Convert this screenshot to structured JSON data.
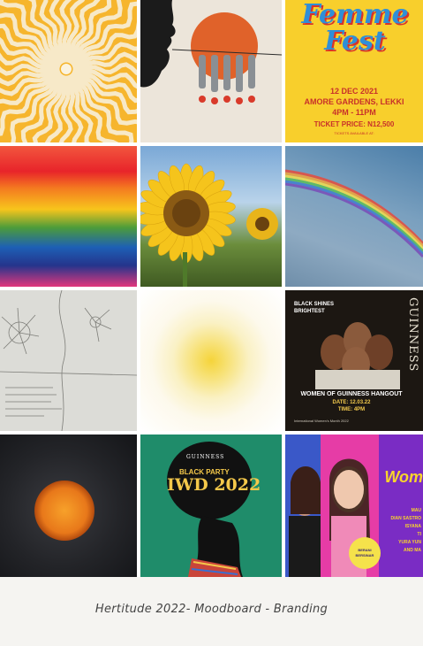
{
  "gallery": {
    "tiles": [
      {
        "name": "sun-rays-artwork"
      },
      {
        "name": "silhouette-bottles-artwork"
      },
      {
        "name": "femme-fest-poster",
        "title": "Femme Fest",
        "date": "12 DEC 2021",
        "venue": "AMORE GARDENS, LEKKI",
        "time": "4PM - 11PM",
        "price": "TICKET PRICE: N12,500",
        "tickets": "TICKETS AVAILABLE AT:"
      },
      {
        "name": "rainbow-paint-texture"
      },
      {
        "name": "sunflower-photo"
      },
      {
        "name": "rainbow-sky-photo"
      },
      {
        "name": "pencil-sketch"
      },
      {
        "name": "glowing-sun-illustration"
      },
      {
        "name": "guinness-hangout-poster",
        "brand": "GUINNESS",
        "tagline": "BLACK SHINES BRIGHTEST",
        "headline": "WOMEN OF GUINNESS HANGOUT",
        "date": "DATE: 12.03.22",
        "time": "TIME: 4PM",
        "footer": "International Women's Month 2022"
      },
      {
        "name": "orange-sun-photo"
      },
      {
        "name": "iwd-2022-poster",
        "brand": "GUINNESS",
        "party": "BLACK PARTY",
        "title": "IWD 2022"
      },
      {
        "name": "women-event-poster",
        "title": "Wom",
        "names": "MAU\nDIAN SASTRO\nISYANA\nTI\nYURA YUN\nAND MA",
        "badge": "BERANI BERSINAR"
      }
    ]
  },
  "caption": "Hertitude 2022- Moodboard - Branding",
  "colors": {
    "caption_text": "#444444",
    "femme_yellow": "#f8cf2c",
    "femme_red": "#c8312a",
    "femme_blue": "#2f8fd8",
    "guinness_gold": "#f2c94c",
    "iwd_green": "#1f8c6a",
    "women_pink": "#e63ca6"
  }
}
